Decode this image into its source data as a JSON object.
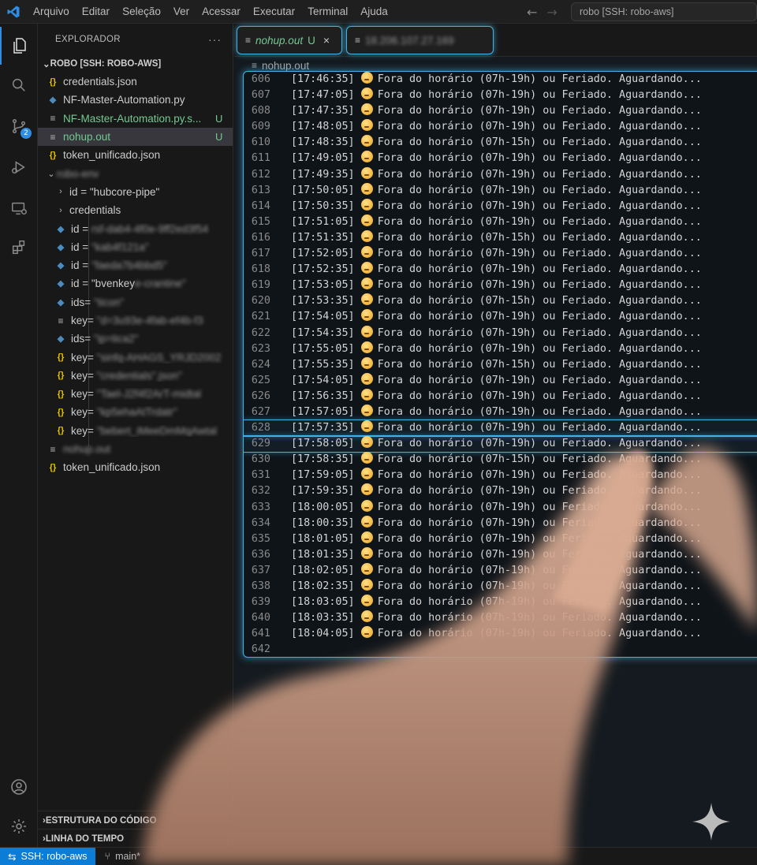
{
  "menu": [
    "Arquivo",
    "Editar",
    "Seleção",
    "Ver",
    "Acessar",
    "Executar",
    "Terminal",
    "Ajuda"
  ],
  "command_center": "robo [SSH: robo-aws]",
  "activity": {
    "scm_badge": "2"
  },
  "explorer": {
    "title": "EXPLORADOR",
    "more": "···",
    "root": "ROBO [SSH: ROBO-AWS]",
    "files": [
      {
        "name": "credentials.json",
        "icon": "json-icon",
        "status": ""
      },
      {
        "name": "NF-Master-Automation.py",
        "icon": "python-icon",
        "status": ""
      },
      {
        "name": "NF-Master-Automation.py.s...",
        "icon": "text-lines-icon",
        "status": "U"
      },
      {
        "name": "nohup.out",
        "icon": "text-lines-icon",
        "status": "U"
      },
      {
        "name": "token_unificado.json",
        "icon": "json-icon",
        "status": ""
      }
    ],
    "tree": {
      "folder_label": "robo-env",
      "rows": [
        {
          "label": "id = \"hubcore-pipe\"",
          "chev": "›",
          "icon": "",
          "blur": "hubcore-pipe"
        },
        {
          "label": "credentials",
          "chev": "›",
          "icon": "",
          "blur": ""
        },
        {
          "label": "id = ",
          "blur": "rsf-dab4-4f0e-9ff2ed3f54",
          "icon": "python-icon"
        },
        {
          "label": "id = ",
          "blur": "\"kab4f121a\"",
          "icon": "python-icon"
        },
        {
          "label": "id = ",
          "blur": "\"faeda7b4bbd5\"",
          "icon": "python-icon"
        },
        {
          "label": "id = \"bvenkey",
          "blur": "e-crantine\"",
          "icon": "python-icon"
        },
        {
          "label": "ids= ",
          "blur": "\"ticon\"",
          "icon": "python-icon"
        },
        {
          "label": "key= ",
          "blur": "\"d=3u93e-4fab-ef4b-f3",
          "icon": "text-lines-icon"
        },
        {
          "label": "ids= ",
          "blur": "\"ip=tica2\"",
          "icon": "python-icon"
        },
        {
          "label": "key= ",
          "blur": "\"sinfq-AHAGS_YRJD2002",
          "icon": "json-icon"
        },
        {
          "label": "key= ",
          "blur": "\"credentials\".json\"",
          "icon": "json-icon"
        },
        {
          "label": "key= ",
          "blur": "\"Tael-J2f4f2ArT-midtal",
          "icon": "json-icon"
        },
        {
          "label": "key= ",
          "blur": "\"kp5ehaAtTrdatr\"",
          "icon": "json-icon"
        },
        {
          "label": "key= ",
          "blur": "\"bebert_iMeeDmMqAwtal",
          "icon": "json-icon"
        }
      ],
      "after": [
        {
          "label": "nohup.out",
          "icon": "text-lines-icon",
          "blur": true
        },
        {
          "label": "token_unificado.json",
          "icon": "json-icon",
          "blur": false
        }
      ]
    },
    "outline": "ESTRUTURA DO CÓDIGO",
    "timeline": "LINHA DO TEMPO"
  },
  "tabs": [
    {
      "name": "nohup.out",
      "status": "U",
      "close": "×"
    },
    {
      "name": "18.206.107.27.169",
      "status": ""
    }
  ],
  "breadcrumb": "nohup.out",
  "log": {
    "message": "Fora do horário (07h-19h) ou Feriado. Aguardando...",
    "lines": [
      {
        "n": "606",
        "time": "[17:46:35]"
      },
      {
        "n": "607",
        "time": "[17:47:05]"
      },
      {
        "n": "608",
        "time": "[17:47:35]"
      },
      {
        "n": "609",
        "time": "[17:48:05]"
      },
      {
        "n": "610",
        "time": "[17:48:35]",
        "msg": "Fora do horário (07h-15h) ou Feriado. Aguardando..."
      },
      {
        "n": "611",
        "time": "[17:49:05]"
      },
      {
        "n": "612",
        "time": "[17:49:35]"
      },
      {
        "n": "613",
        "time": "[17:50:05]"
      },
      {
        "n": "614",
        "time": "[17:50:35]"
      },
      {
        "n": "615",
        "time": "[17:51:05]"
      },
      {
        "n": "616",
        "time": "[17:51:35]",
        "msg": "Fora do horário (07h-15h) ou Feriado. Aguardando..."
      },
      {
        "n": "617",
        "time": "[17:52:05]"
      },
      {
        "n": "618",
        "time": "[17:52:35]"
      },
      {
        "n": "619",
        "time": "[17:53:05]"
      },
      {
        "n": "620",
        "time": "[17:53:35]",
        "msg": "Fora do horário (07h-15h) ou Feriado. Aguardando..."
      },
      {
        "n": "621",
        "time": "[17:54:05]"
      },
      {
        "n": "622",
        "time": "[17:54:35]"
      },
      {
        "n": "623",
        "time": "[17:55:05]"
      },
      {
        "n": "624",
        "time": "[17:55:35]",
        "msg": "Fora do horário (07h-15h) ou Feriado. Aguardando..."
      },
      {
        "n": "625",
        "time": "[17:54:05]"
      },
      {
        "n": "626",
        "time": "[17:56:35]"
      },
      {
        "n": "627",
        "time": "[17:57:05]"
      },
      {
        "n": "628",
        "time": "[17:57:35]",
        "hl": true
      },
      {
        "n": "629",
        "time": "[17:58:05]",
        "hl": true
      },
      {
        "n": "630",
        "time": "[17:58:35]",
        "msg": "Fora do horário (07h-15h) ou Feriado. Aguardando..."
      },
      {
        "n": "631",
        "time": "[17:59:05]"
      },
      {
        "n": "632",
        "time": "[17:59:35]"
      },
      {
        "n": "633",
        "time": "[18:00:05]"
      },
      {
        "n": "634",
        "time": "[18:00:35]"
      },
      {
        "n": "635",
        "time": "[18:01:05]"
      },
      {
        "n": "636",
        "time": "[18:01:35]"
      },
      {
        "n": "637",
        "time": "[18:02:05]"
      },
      {
        "n": "638",
        "time": "[18:02:35]"
      },
      {
        "n": "639",
        "time": "[18:03:05]"
      },
      {
        "n": "640",
        "time": "[18:03:35]"
      },
      {
        "n": "641",
        "time": "[18:04:05]"
      },
      {
        "n": "642",
        "time": "",
        "msg": ""
      }
    ]
  },
  "statusbar": {
    "remote": "SSH: robo-aws",
    "branch": "main*"
  }
}
